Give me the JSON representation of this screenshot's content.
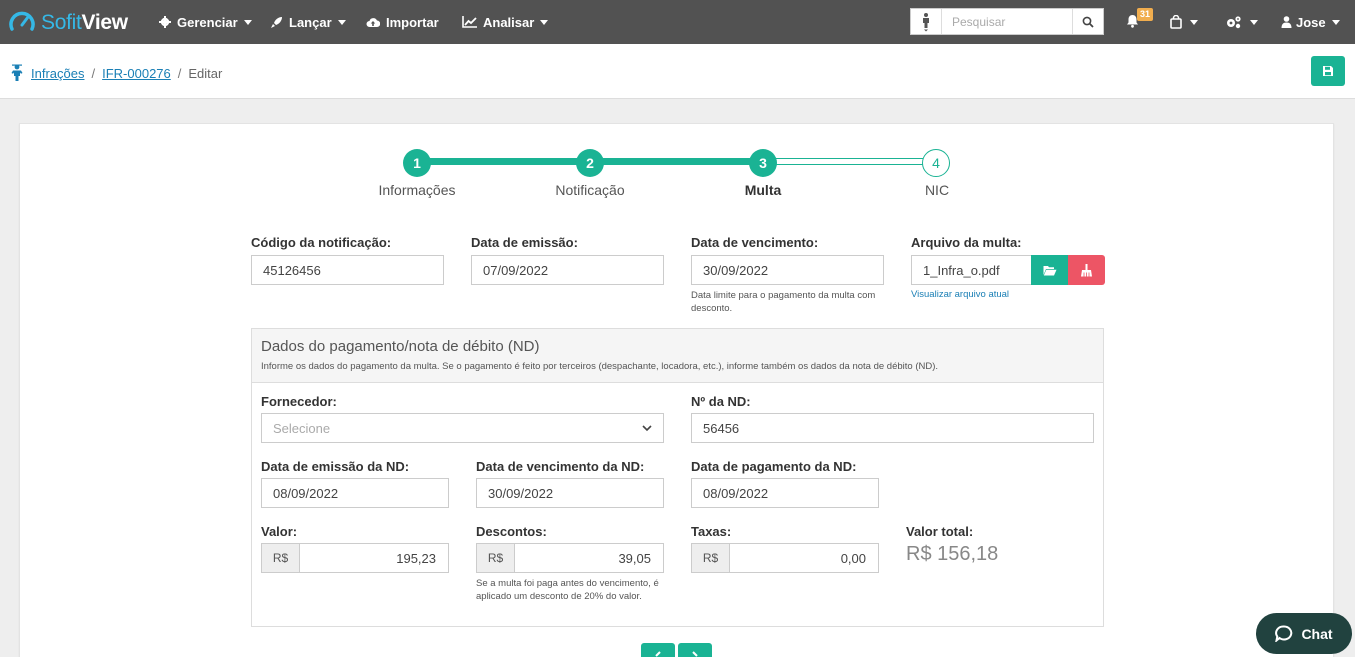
{
  "header": {
    "logo_sofit": "Sofit",
    "logo_view": "View",
    "nav": [
      {
        "label": "Gerenciar",
        "icon": "gear-icon"
      },
      {
        "label": "Lançar",
        "icon": "rocket-icon"
      },
      {
        "label": "Importar",
        "icon": "cloud-upload-icon"
      },
      {
        "label": "Analisar",
        "icon": "line-chart-icon"
      }
    ],
    "search_placeholder": "Pesquisar",
    "notifications_count": "31",
    "user_name": "Jose"
  },
  "breadcrumb": {
    "items": [
      "Infrações",
      "IFR-000276"
    ],
    "current": "Editar"
  },
  "stepper": {
    "steps": [
      {
        "number": "1",
        "label": "Informações",
        "state": "done"
      },
      {
        "number": "2",
        "label": "Notificação",
        "state": "done"
      },
      {
        "number": "3",
        "label": "Multa",
        "state": "active"
      },
      {
        "number": "4",
        "label": "NIC",
        "state": "todo"
      }
    ],
    "accent": "#1ab394"
  },
  "form": {
    "codigo_label": "Código da notificação:",
    "codigo_value": "45126456",
    "emissao_label": "Data de emissão:",
    "emissao_value": "07/09/2022",
    "vencimento_label": "Data de vencimento:",
    "vencimento_value": "30/09/2022",
    "vencimento_help": "Data limite para o pagamento da multa com desconto.",
    "arquivo_label": "Arquivo da multa:",
    "arquivo_value": "1_Infra_o.pdf",
    "arquivo_link": "Visualizar arquivo atual"
  },
  "payment": {
    "title": "Dados do pagamento/nota de débito (ND)",
    "subtitle": "Informe os dados do pagamento da multa. Se o pagamento é feito por terceiros (despachante, locadora, etc.), informe também os dados da nota de débito (ND).",
    "fornecedor_label": "Fornecedor:",
    "fornecedor_placeholder": "Selecione",
    "nd_label": "Nº da ND:",
    "nd_value": "56456",
    "emissao_nd_label": "Data de emissão da ND:",
    "emissao_nd_value": "08/09/2022",
    "venc_nd_label": "Data de vencimento da ND:",
    "venc_nd_value": "30/09/2022",
    "pag_nd_label": "Data de pagamento da ND:",
    "pag_nd_value": "08/09/2022",
    "valor_label": "Valor:",
    "valor_value": "195,23",
    "descontos_label": "Descontos:",
    "descontos_value": "39,05",
    "descontos_help": "Se a multa foi paga antes do vencimento, é aplicado um desconto de 20% do valor.",
    "taxas_label": "Taxas:",
    "taxas_value": "0,00",
    "currency": "R$",
    "total_label": "Valor total:",
    "total_value": "R$ 156,18"
  },
  "chat_label": "Chat"
}
